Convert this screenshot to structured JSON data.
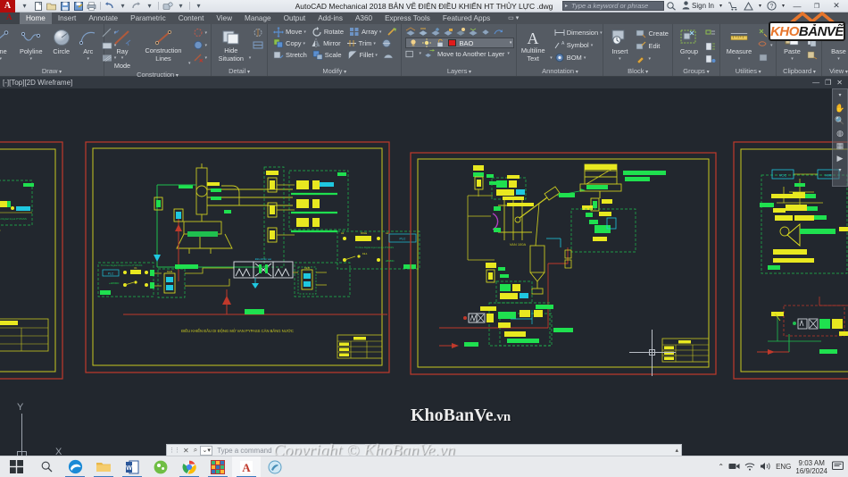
{
  "titlebar": {
    "app_title": "AutoCAD Mechanical 2018    BẢN VẼ ĐIỆN ĐIỀU KHIỂN HT THỦY LỰC .dwg",
    "quick_access": [
      "new-icon",
      "open-icon",
      "save-icon",
      "save-as-icon",
      "plot-icon",
      "undo-icon",
      "redo-icon",
      "workspace-icon"
    ],
    "search_placeholder": "Type a keyword or phrase",
    "sign_in": "Sign In",
    "minimize": "—",
    "maximize": "❐",
    "close": "✕"
  },
  "tabs": [
    {
      "label": "Home",
      "active": true
    },
    {
      "label": "Insert",
      "active": false
    },
    {
      "label": "Annotate",
      "active": false
    },
    {
      "label": "Parametric",
      "active": false
    },
    {
      "label": "Content",
      "active": false
    },
    {
      "label": "View",
      "active": false
    },
    {
      "label": "Manage",
      "active": false
    },
    {
      "label": "Output",
      "active": false
    },
    {
      "label": "Add-ins",
      "active": false
    },
    {
      "label": "A360",
      "active": false
    },
    {
      "label": "Express Tools",
      "active": false
    },
    {
      "label": "Featured Apps",
      "active": false
    }
  ],
  "ribbon": {
    "draw": {
      "title": "Draw",
      "line": "Line",
      "polyline": "Polyline",
      "circle": "Circle",
      "arc": "Arc"
    },
    "construction": {
      "title": "Construction",
      "ray_mode": "Ray\nMode",
      "ray_mode_l1": "Ray",
      "ray_mode_l2": "Mode",
      "construction_lines_l1": "Construction",
      "construction_lines_l2": "Lines"
    },
    "detail": {
      "title": "Detail",
      "hide_l1": "Hide",
      "hide_l2": "Situation"
    },
    "modify": {
      "title": "Modify",
      "move": "Move",
      "rotate": "Rotate",
      "array": "Array",
      "copy": "Copy",
      "mirror": "Mirror",
      "trim": "Trim",
      "stretch": "Stretch",
      "scale": "Scale",
      "fillet": "Fillet"
    },
    "layers": {
      "title": "Layers",
      "current_layer": "BAO",
      "layer_color": "#e01b1b",
      "move_to_layer": "Move to Another Layer"
    },
    "annotation": {
      "title": "Annotation",
      "multiline_l1": "Multiline",
      "multiline_l2": "Text",
      "dimension": "Dimension",
      "symbol": "Symbol",
      "bom": "BOM"
    },
    "block": {
      "title": "Block",
      "insert": "Insert",
      "create": "Create",
      "edit": "Edit"
    },
    "groups": {
      "title": "Groups",
      "group": "Group"
    },
    "utilities": {
      "title": "Utilities",
      "measure": "Measure"
    },
    "clipboard": {
      "title": "Clipboard",
      "paste": "Paste"
    },
    "view": {
      "title": "View",
      "base": "Base"
    }
  },
  "logo": {
    "part1": "KHO",
    "part2": "BẢNVẼ"
  },
  "canvas": {
    "doc_tab": "[-][Top][2D Wireframe]",
    "win_minimize": "—",
    "win_restore": "❐",
    "win_close": "✕",
    "watermark_center": "KhoBanVe",
    "watermark_center_suffix": ".vn",
    "watermark_bottom": "Copyright © KhoBanVe.vn",
    "ucs_x": "X",
    "ucs_y": "Y",
    "nav_items": [
      "nav-wheel-icon",
      "pan-hand-icon",
      "zoom-icon",
      "orbit-icon",
      "viewcube-icon",
      "play-icon",
      "more-icon"
    ]
  },
  "drawings": {
    "sheet1_caption": "ĐIỀU KHIỂN ĐẦU DI ĐỘNG MỞ VAN PYPASS CÂN BẰNG NƯỚC",
    "sheet2_label": "VAN 100A",
    "labels": {
      "plc": "PLC",
      "vcc": "VCC",
      "power": "24VDC",
      "k1": "K1",
      "k2": "K2",
      "note_in": "Tín hiệu Digital Output từ bộ PYPASS",
      "note_out": "Tín hiệu Digital Input vào bộ PYPASS"
    }
  },
  "command_bar": {
    "placeholder": "Type a command",
    "close_icon": "✕",
    "search_icon": "⌕"
  },
  "taskbar": {
    "items": [
      {
        "name": "start-button",
        "glyph": "⊞"
      },
      {
        "name": "search-icon",
        "glyph": "⌕"
      },
      {
        "name": "edge-icon",
        "glyph": "e"
      },
      {
        "name": "file-explorer-icon",
        "glyph": "▭"
      },
      {
        "name": "word-icon",
        "glyph": "W"
      },
      {
        "name": "paint3d-icon",
        "glyph": "◔"
      },
      {
        "name": "chrome-icon",
        "glyph": "●"
      },
      {
        "name": "app-icon",
        "glyph": "▦"
      },
      {
        "name": "autocad-icon",
        "glyph": "A"
      },
      {
        "name": "misc-icon",
        "glyph": "◑"
      }
    ],
    "tray": {
      "chevron": "⌃",
      "device_icon": "device-icon",
      "network_icon": "network-icon",
      "volume_icon": "ὐA",
      "language": "ENG",
      "time": "9:03 AM",
      "date": "16/9/2024",
      "notification_icon": "὚5"
    }
  }
}
